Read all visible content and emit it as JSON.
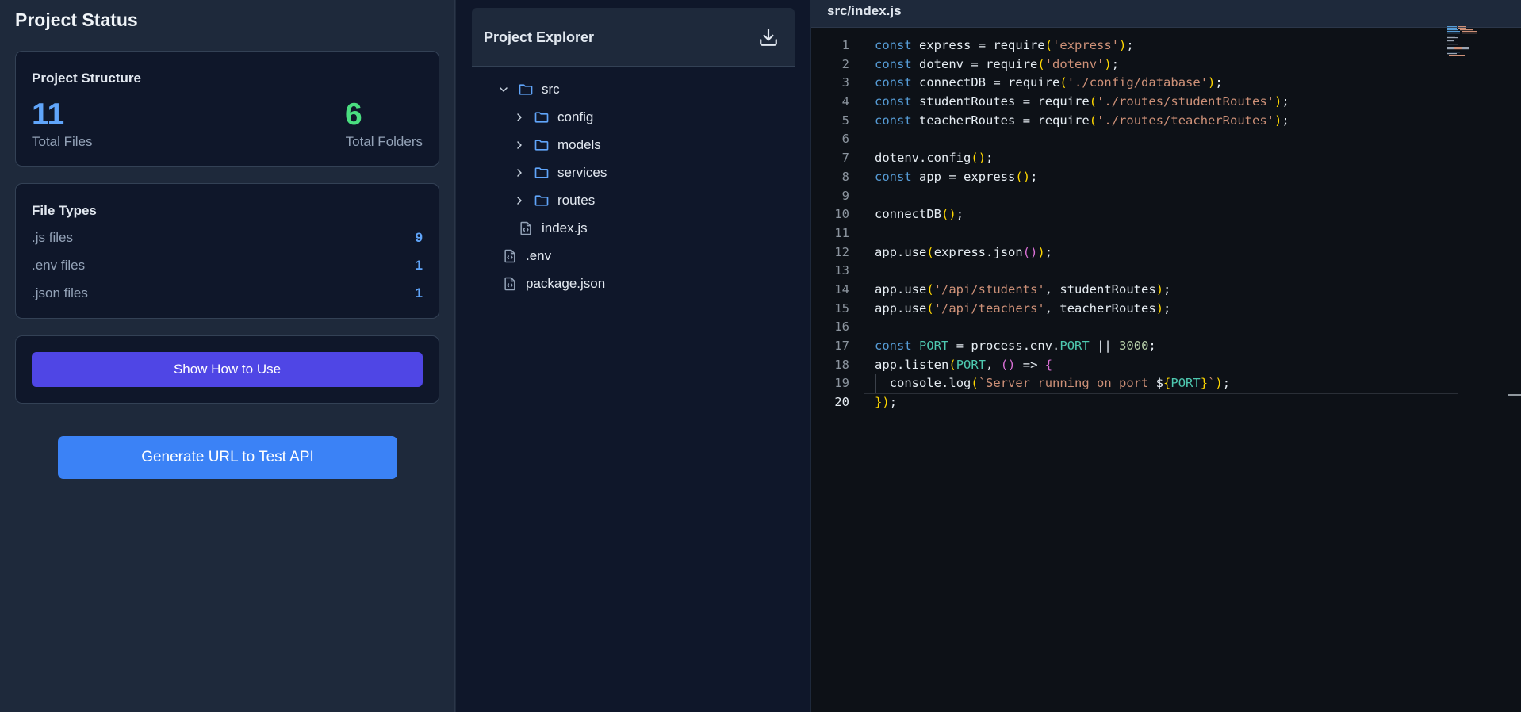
{
  "left": {
    "title": "Project Status",
    "structure": {
      "title": "Project Structure",
      "total_files": "11",
      "total_files_label": "Total Files",
      "total_folders": "6",
      "total_folders_label": "Total Folders"
    },
    "file_types": {
      "title": "File Types",
      "rows": [
        {
          "name": ".js files",
          "count": "9"
        },
        {
          "name": ".env files",
          "count": "1"
        },
        {
          "name": ".json files",
          "count": "1"
        }
      ]
    },
    "show_how_label": "Show How to Use",
    "generate_label": "Generate URL to Test API"
  },
  "explorer": {
    "title": "Project Explorer",
    "items": [
      {
        "label": "src",
        "icon": "folder-icon",
        "chevron": "chevron-down-icon"
      },
      {
        "label": "config",
        "icon": "folder-icon",
        "chevron": "chevron-right-icon"
      },
      {
        "label": "models",
        "icon": "folder-icon",
        "chevron": "chevron-right-icon"
      },
      {
        "label": "services",
        "icon": "folder-icon",
        "chevron": "chevron-right-icon"
      },
      {
        "label": "routes",
        "icon": "folder-icon",
        "chevron": "chevron-right-icon"
      },
      {
        "label": "index.js",
        "icon": "file-code-icon"
      },
      {
        "label": ".env",
        "icon": "file-code-icon"
      },
      {
        "label": "package.json",
        "icon": "file-code-icon"
      }
    ]
  },
  "editor": {
    "tab_title": "src/index.js",
    "active_line": 20,
    "lines": [
      {
        "n": "1",
        "text": "const express = require('express');"
      },
      {
        "n": "2",
        "text": "const dotenv = require('dotenv');"
      },
      {
        "n": "3",
        "text": "const connectDB = require('./config/database');"
      },
      {
        "n": "4",
        "text": "const studentRoutes = require('./routes/studentRoutes');"
      },
      {
        "n": "5",
        "text": "const teacherRoutes = require('./routes/teacherRoutes');"
      },
      {
        "n": "6",
        "text": ""
      },
      {
        "n": "7",
        "text": "dotenv.config();"
      },
      {
        "n": "8",
        "text": "const app = express();"
      },
      {
        "n": "9",
        "text": ""
      },
      {
        "n": "10",
        "text": "connectDB();"
      },
      {
        "n": "11",
        "text": ""
      },
      {
        "n": "12",
        "text": "app.use(express.json());"
      },
      {
        "n": "13",
        "text": ""
      },
      {
        "n": "14",
        "text": "app.use('/api/students', studentRoutes);"
      },
      {
        "n": "15",
        "text": "app.use('/api/teachers', teacherRoutes);"
      },
      {
        "n": "16",
        "text": ""
      },
      {
        "n": "17",
        "text": "const PORT = process.env.PORT || 3000;"
      },
      {
        "n": "18",
        "text": "app.listen(PORT, () => {"
      },
      {
        "n": "19",
        "text": "  console.log(`Server running on port ${PORT}`);"
      },
      {
        "n": "20",
        "text": "});"
      }
    ]
  },
  "colors": {
    "accent_blue": "#60a5fa",
    "accent_green": "#4ade80",
    "button_indigo": "#4f46e5",
    "button_blue": "#3b82f6",
    "panel_bg": "#1e293b",
    "card_bg": "#0f172a"
  }
}
